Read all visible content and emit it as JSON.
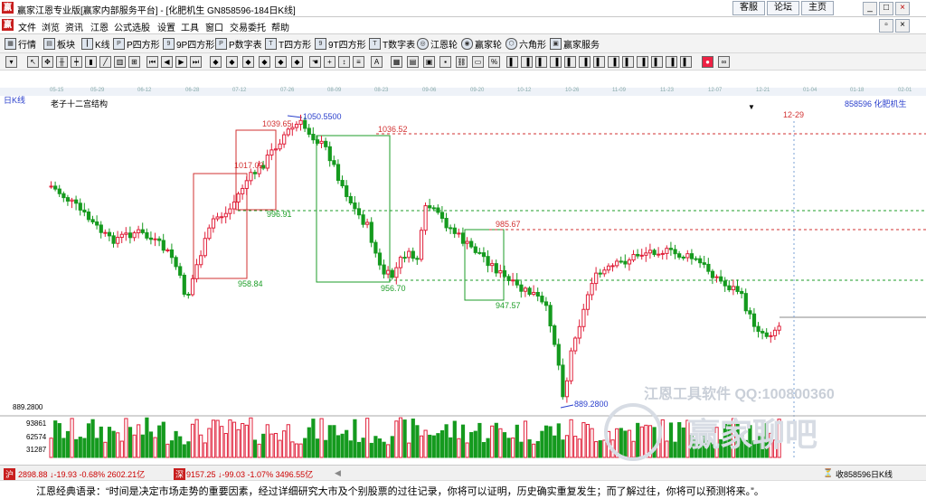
{
  "window": {
    "title": "赢家江恩专业版[赢家内部服务平台] - [化肥机生  GN858596-184日K线]",
    "links": [
      "客服",
      "论坛",
      "主页"
    ]
  },
  "menu": [
    "文件",
    "浏览",
    "资讯",
    "江恩",
    "公式选股",
    "设置",
    "工具",
    "窗口",
    "交易委托",
    "帮助"
  ],
  "toolbar": [
    "行情",
    "板块",
    "K线",
    "P四方形",
    "9P四方形",
    "P数字表",
    "T四方形",
    "9T四方形",
    "T数字表",
    "江恩轮",
    "赢家轮",
    "六角形",
    "赢家服务"
  ],
  "dates": [
    "05-15",
    "05-29",
    "06-12",
    "06-28",
    "07-12",
    "07-26",
    "08-09",
    "08-23",
    "09-06",
    "09-20",
    "10-12",
    "10-26",
    "11-09",
    "11-23",
    "12-07",
    "12-21",
    "01-04",
    "01-18",
    "02-01"
  ],
  "chart": {
    "period_label": "日K线",
    "indicator_label": "老子十二宫结构",
    "instrument": "858596 化肥机生",
    "marker_date": "12-29",
    "price_labels": {
      "high": "1050.5500",
      "p1": "1039.65",
      "p2": "1036.52",
      "p3": "1017.02",
      "p4": "996.91",
      "p5": "985.67",
      "p6": "958.84",
      "p7": "956.70",
      "p8": "947.57",
      "low": "889.2800"
    },
    "volume_axis": [
      "93861",
      "62574",
      "31287"
    ],
    "volume_price": "889.2800"
  },
  "chart_data": {
    "type": "candlestick",
    "ylim": [
      889.28,
      1050.55
    ]
  },
  "watermark": {
    "line1": "江恩工具软件  QQ:100800360",
    "line2": "赢家聊吧"
  },
  "status": {
    "sh": "2898.88 ↓-19.93 -0.68% 2602.21亿",
    "sz": "9157.25 ↓-99.03 -1.07% 3496.55亿",
    "right": "收858596日K线"
  },
  "quote": "江恩经典语录：“时间是决定市场走势的重要因素，经过详细研究大市及个别股票的过往记录，你将可以证明，历史确实重复发生；而了解过往，你将可以预测将来。”。",
  "colors": {
    "up": "#e0203a",
    "down": "#159a1e",
    "box_red": "#d23232",
    "box_green": "#1e9e28",
    "blue": "#2a3fcc"
  }
}
